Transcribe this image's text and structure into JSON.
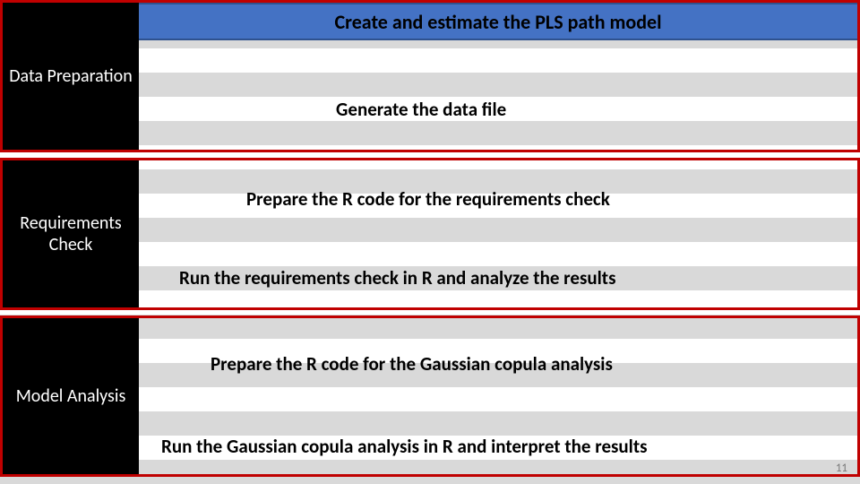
{
  "banner": "Create and estimate the PLS path model",
  "sections": [
    {
      "label": "Data Preparation",
      "steps": [
        "Generate the data file"
      ]
    },
    {
      "label": "Requirements Check",
      "steps": [
        "Prepare the R code for the requirements check",
        "Run the requirements check in R and analyze the results"
      ]
    },
    {
      "label": "Model Analysis",
      "steps": [
        "Prepare the R code for the Gaussian copula analysis",
        "Run the Gaussian copula analysis in R and interpret the results"
      ]
    }
  ],
  "page_number": "11"
}
